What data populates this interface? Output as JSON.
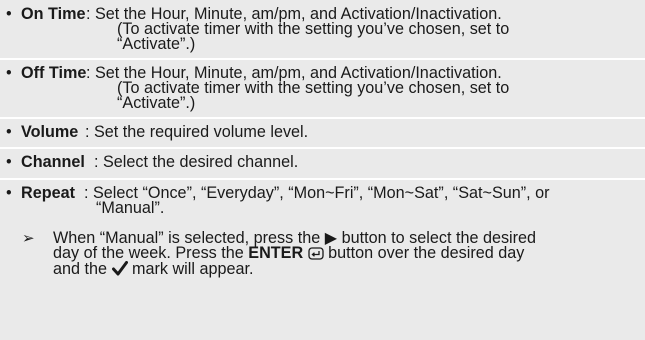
{
  "items": [
    {
      "bullet": "•",
      "label": "On Time",
      "line1": ": Set the Hour, Minute, am/pm, and Activation/Inactivation.",
      "line2": "(To activate timer with the setting you’ve chosen, set to",
      "line3": "“Activate”.)"
    },
    {
      "bullet": "•",
      "label": "Off Time",
      "line1": ": Set the Hour, Minute, am/pm, and Activation/Inactivation.",
      "line2": "(To activate timer with the setting you’ve chosen, set to",
      "line3": "“Activate”.)"
    },
    {
      "bullet": "•",
      "label": "Volume",
      "line1": ": Set the required volume level."
    },
    {
      "bullet": "•",
      "label": "Channel",
      "line1": ": Select the desired channel."
    },
    {
      "bullet": "•",
      "label": "Repeat",
      "line1": ": Select “Once”, “Everyday”, “Mon~Fri”, “Mon~Sat”, “Sat~Sun”, or",
      "line2": "“Manual”."
    }
  ],
  "note": {
    "arrow": "➢",
    "line1a": "When “Manual” is selected, press the",
    "line1_symbol": "▶",
    "line1b": "button to select the desired",
    "line2a": "day of the week. Press the",
    "line2_bold": "ENTER",
    "line2b": "button over the desired day",
    "line3a": "and the",
    "line3b": "mark will appear."
  }
}
